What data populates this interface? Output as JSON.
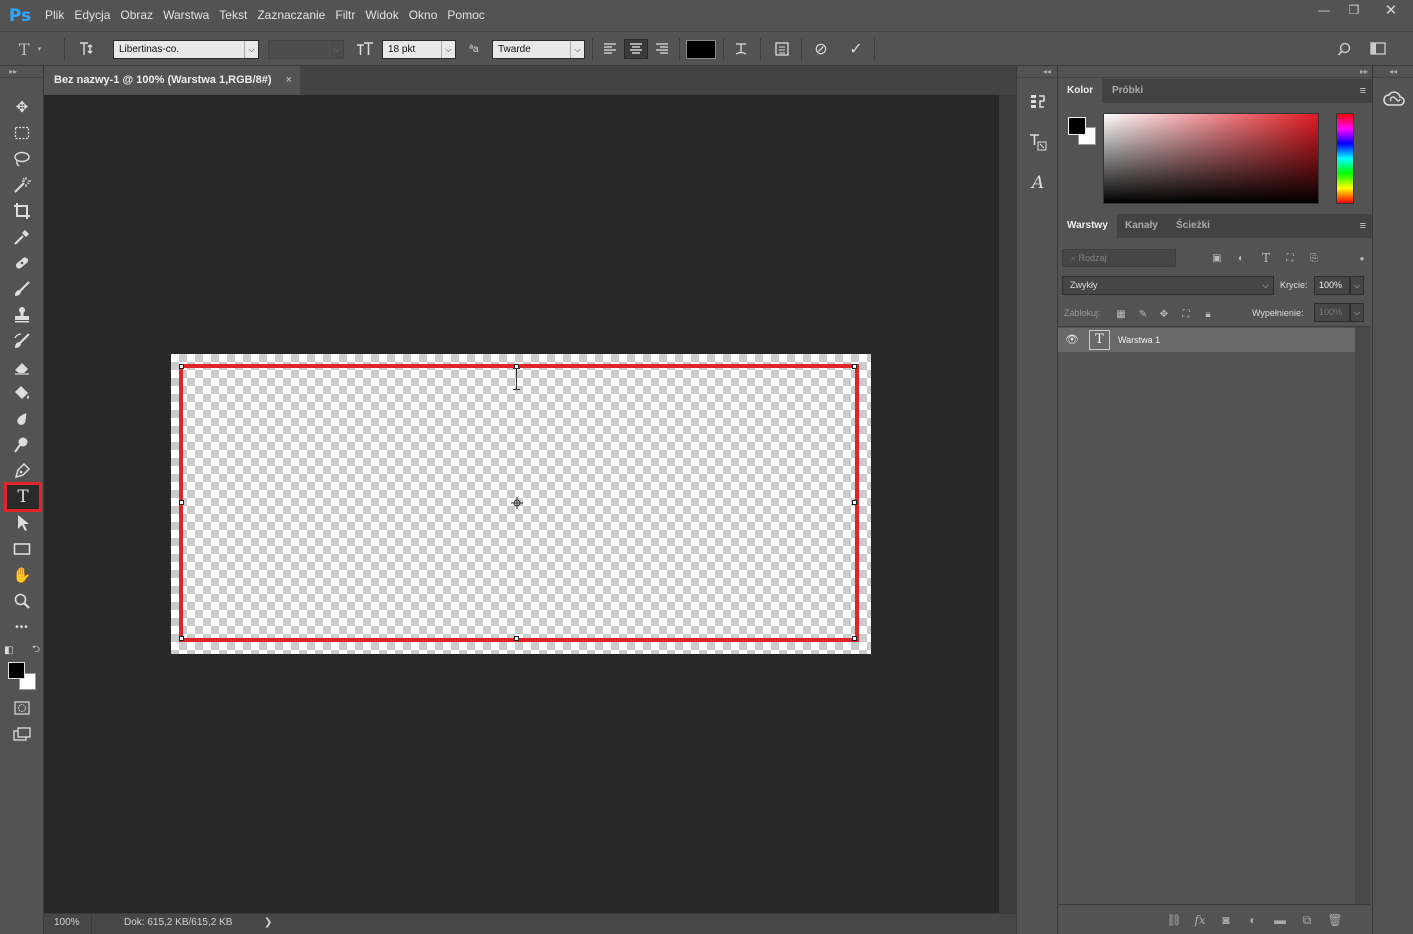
{
  "app": {
    "logo": "Ps",
    "menu": [
      "Plik",
      "Edycja",
      "Obraz",
      "Warstwa",
      "Tekst",
      "Zaznaczanie",
      "Filtr",
      "Widok",
      "Okno",
      "Pomoc"
    ],
    "window_controls": {
      "minimize": "—",
      "maximize": "❐",
      "close": "✕"
    }
  },
  "options_bar": {
    "tool_icon": "type-tool-icon",
    "font_family": "Libertinas-co.",
    "font_style": "",
    "font_size": "18 pkt",
    "anti_alias": "Twarde",
    "text_color": "#000000",
    "align": [
      "left",
      "center",
      "right"
    ],
    "active_align": "center"
  },
  "toolbar": {
    "active_tool": "type-tool",
    "tools": [
      "move",
      "marquee",
      "lasso",
      "magic-wand",
      "crop",
      "eyedropper",
      "healing-brush",
      "brush",
      "clone-stamp",
      "history-brush",
      "eraser",
      "paint-bucket",
      "blur",
      "dodge",
      "pen",
      "type",
      "path-selection",
      "rectangle",
      "hand",
      "zoom",
      "more"
    ],
    "foreground": "#000000",
    "background": "#ffffff",
    "type_tool_glyph": "T",
    "more_glyph": "•••"
  },
  "document": {
    "tab_title": "Bez nazwy-1 @ 100% (Warstwa 1,RGB/8#)",
    "tab_close": "×",
    "zoom": "100%",
    "doc_info": "Dok: 615,2 KB/615,2 KB",
    "status_arrow": "❯"
  },
  "color_panel": {
    "tabs": [
      "Kolor",
      "Próbki"
    ],
    "active_tab": "Kolor",
    "foreground": "#000000",
    "background": "#ffffff",
    "hue_color": "#e11c24"
  },
  "layers_panel": {
    "tabs": [
      "Warstwy",
      "Kanały",
      "Ścieżki"
    ],
    "active_tab": "Warstwy",
    "search_placeholder": "Rodzaj",
    "blend_mode": "Zwykły",
    "opacity_label": "Krycie:",
    "opacity_value": "100%",
    "lock_label": "Zablokuj:",
    "fill_label": "Wypełnienie:",
    "fill_value": "100%",
    "layers": [
      {
        "name": "Warstwa 1",
        "type": "text",
        "visible": true,
        "thumb_glyph": "T"
      }
    ]
  },
  "side_icons": {
    "mid": [
      "history-icon",
      "character-style-icon",
      "character-icon"
    ],
    "cc": "creative-cloud-icon"
  }
}
